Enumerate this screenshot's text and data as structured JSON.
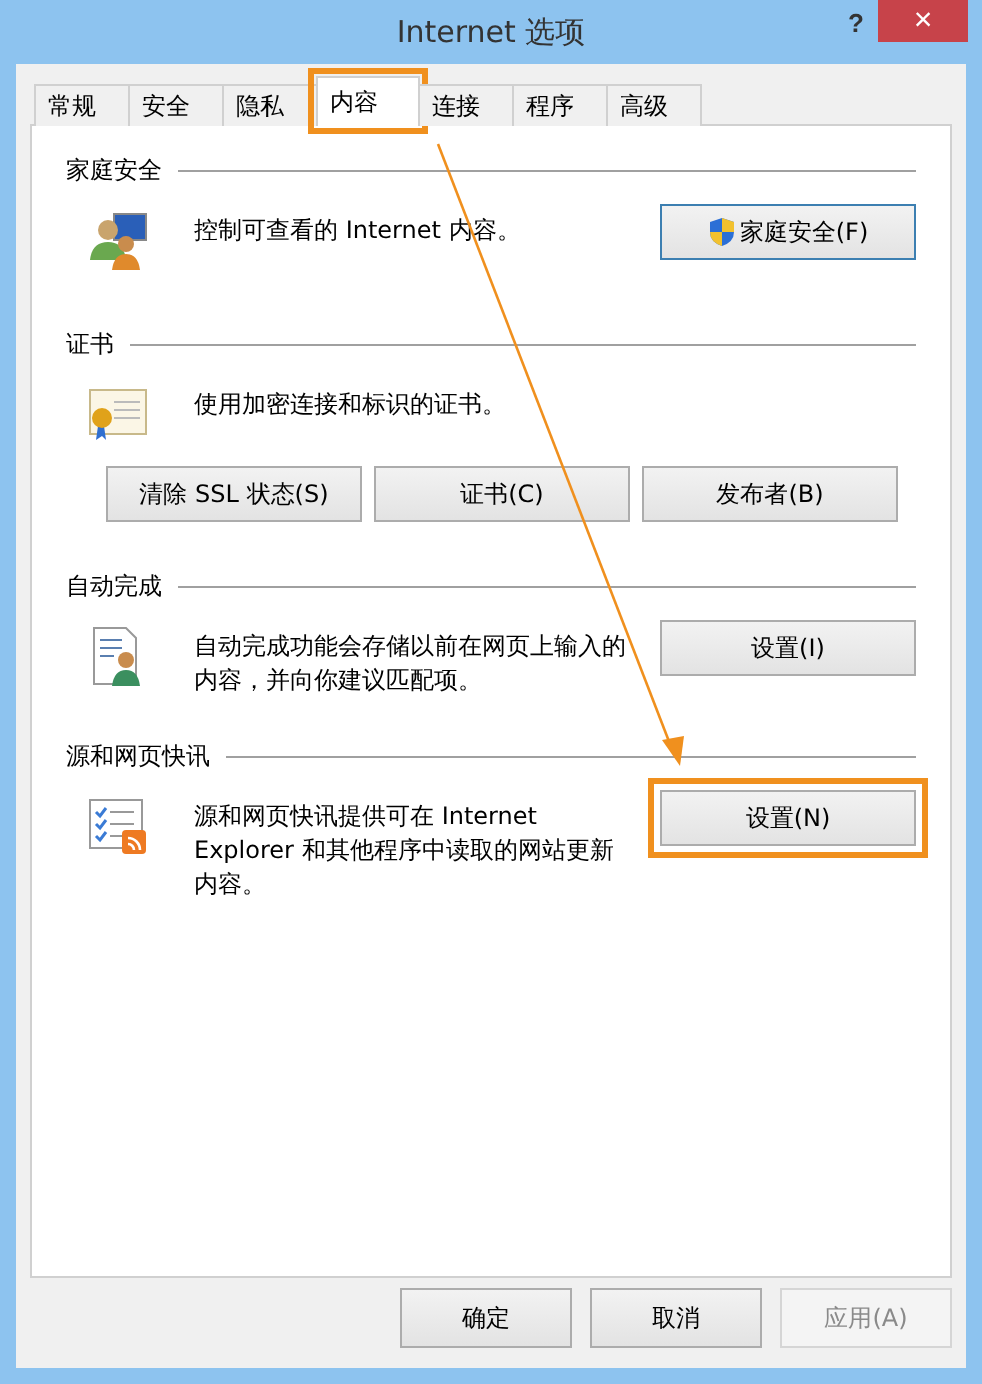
{
  "window": {
    "title": "Internet 选项",
    "help": "?",
    "close": "×"
  },
  "tabs": [
    {
      "label": "常规",
      "selected": false,
      "highlighted": false
    },
    {
      "label": "安全",
      "selected": false,
      "highlighted": false
    },
    {
      "label": "隐私",
      "selected": false,
      "highlighted": false
    },
    {
      "label": "内容",
      "selected": true,
      "highlighted": true
    },
    {
      "label": "连接",
      "selected": false,
      "highlighted": false
    },
    {
      "label": "程序",
      "selected": false,
      "highlighted": false
    },
    {
      "label": "高级",
      "selected": false,
      "highlighted": false
    }
  ],
  "sections": [
    {
      "title": "家庭安全",
      "description": "控制可查看的 Internet 内容。",
      "side_button": {
        "label": "家庭安全(F)",
        "default": true,
        "shield_icon": true,
        "highlighted": false
      }
    },
    {
      "title": "证书",
      "description": "使用加密连接和标识的证书。",
      "row_buttons": [
        "清除 SSL 状态(S)",
        "证书(C)",
        "发布者(B)"
      ]
    },
    {
      "title": "自动完成",
      "description": "自动完成功能会存储以前在网页上输入的内容，并向你建议匹配项。",
      "side_button": {
        "label": "设置(I)",
        "default": false,
        "highlighted": false
      }
    },
    {
      "title": "源和网页快讯",
      "description": "源和网页快讯提供可在 Internet Explorer 和其他程序中读取的网站更新内容。",
      "side_button": {
        "label": "设置(N)",
        "default": false,
        "highlighted": true
      }
    }
  ],
  "annotation": {
    "arrow": true
  },
  "dialog_buttons": [
    {
      "label": "确定",
      "disabled": false
    },
    {
      "label": "取消",
      "disabled": false
    },
    {
      "label": "应用(A)",
      "disabled": true
    }
  ]
}
